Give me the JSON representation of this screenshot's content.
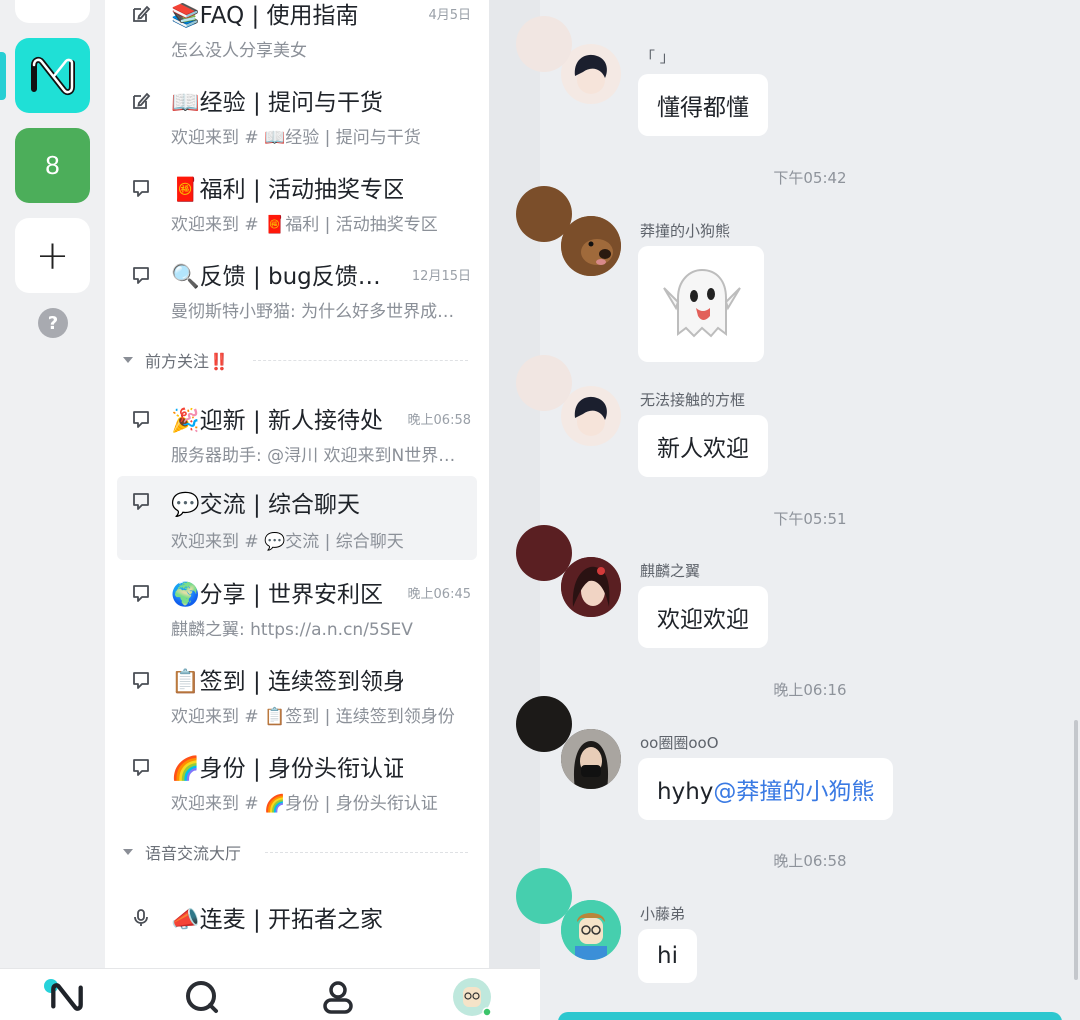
{
  "rail": {
    "servers": [
      "8"
    ],
    "add_label": "+",
    "help_label": "?"
  },
  "channels": [
    {
      "icon": "edit-icon",
      "name": "📚FAQ | 使用指南",
      "time": "4月5日",
      "sub": "怎么没人分享美女"
    },
    {
      "icon": "edit-icon",
      "name": "📖经验 | 提问与干货",
      "time": "",
      "sub": "欢迎来到 # 📖经验 | 提问与干货"
    },
    {
      "icon": "chat-icon",
      "name": "🧧福利 | 活动抽奖专区",
      "time": "",
      "sub": "欢迎来到 # 🧧福利 | 活动抽奖专区"
    },
    {
      "icon": "chat-icon",
      "name": "🔍反馈 | bug反馈…",
      "time": "12月15日",
      "sub": "曼彻斯特小野猫: 为什么好多世界成…"
    },
    {
      "icon": "chat-icon",
      "name": "🎉迎新 | 新人接待处",
      "time": "晚上06:58",
      "sub": "服务器助手: @浔川 欢迎来到N世界…"
    },
    {
      "icon": "chat-icon",
      "name": "💬交流 | 综合聊天",
      "time": "",
      "sub": "欢迎来到 # 💬交流 | 综合聊天"
    },
    {
      "icon": "chat-icon",
      "name": "🌍分享 | 世界安利区",
      "time": "晚上06:45",
      "sub": "麒麟之翼: https://a.n.cn/5SEV"
    },
    {
      "icon": "chat-icon",
      "name": "📋签到 | 连续签到领身份",
      "time": "",
      "sub": "欢迎来到 # 📋签到 | 连续签到领身份"
    },
    {
      "icon": "chat-icon",
      "name": "🌈身份 | 身份头衔认证",
      "time": "",
      "sub": "欢迎来到 # 🌈身份 | 身份头衔认证"
    },
    {
      "icon": "mic-icon",
      "name": "📣连麦 | 开拓者之家",
      "time": "",
      "sub": ""
    }
  ],
  "categories": [
    "前方关注‼️",
    "语音交流大厅"
  ],
  "chat": {
    "messages": [
      {
        "name": "「 」",
        "text": "懂得都懂"
      },
      {
        "time": "下午05:42"
      },
      {
        "name": "莽撞的小狗熊",
        "text": "👻"
      },
      {
        "name": "无法接触的方框",
        "text": "新人欢迎"
      },
      {
        "time": "下午05:51"
      },
      {
        "name": "麒麟之翼",
        "text": "欢迎欢迎"
      },
      {
        "time": "晚上06:16"
      },
      {
        "name": "oo圈圈ooO",
        "text": "hyhy",
        "mention": "@莽撞的小狗熊"
      },
      {
        "time": "晚上06:58"
      },
      {
        "name": "小藤弟",
        "text": "hi"
      }
    ]
  },
  "colors": {
    "accent": "#1fe0d6",
    "green_server": "#4cae5a",
    "mention": "#3a7ae3"
  }
}
